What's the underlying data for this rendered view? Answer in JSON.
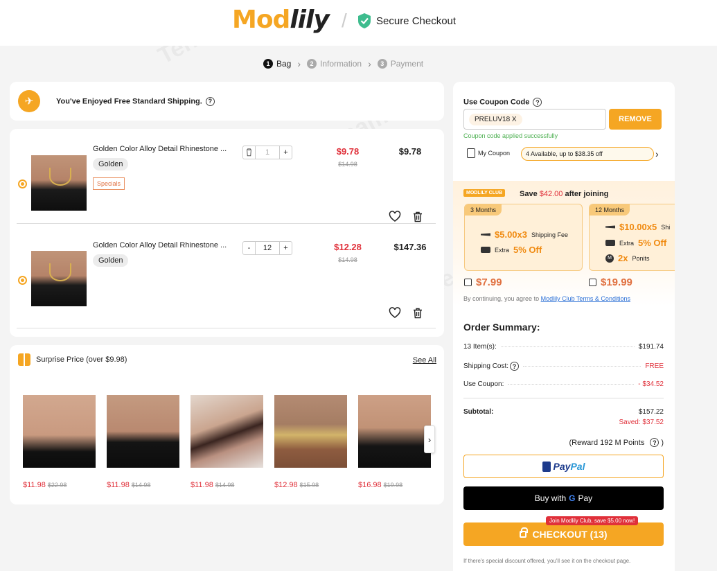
{
  "header": {
    "logo_part1": "Mod",
    "logo_part2": "lily",
    "secure_label": "Secure Checkout"
  },
  "steps": [
    {
      "num": "1",
      "label": "Bag"
    },
    {
      "num": "2",
      "label": "Information"
    },
    {
      "num": "3",
      "label": "Payment"
    }
  ],
  "shipping": {
    "text": "You've Enjoyed Free Standard Shipping."
  },
  "bag": {
    "items": [
      {
        "name": "Golden Color Alloy Detail Rhinestone ...",
        "variant": "Golden",
        "badge": "Specials",
        "qty": "1",
        "price": "$9.78",
        "original": "$14.98",
        "total": "$9.78"
      },
      {
        "name": "Golden Color Alloy Detail Rhinestone ...",
        "variant": "Golden",
        "qty": "12",
        "price": "$12.28",
        "original": "$14.98",
        "total": "$147.36"
      }
    ],
    "minus": "-",
    "plus": "+"
  },
  "surprise": {
    "title": "Surprise Price (over $9.98)",
    "see_all": "See All",
    "products": [
      {
        "price": "$11.98",
        "original": "$22.98"
      },
      {
        "price": "$11.98",
        "original": "$14.98"
      },
      {
        "price": "$11.98",
        "original": "$14.98"
      },
      {
        "price": "$12.98",
        "original": "$15.98"
      },
      {
        "price": "$16.98",
        "original": "$19.98"
      }
    ],
    "next": "›"
  },
  "coupon": {
    "label": "Use Coupon Code",
    "applied_code": "PRELUV18  X",
    "remove": "REMOVE",
    "success": "Coupon code applied successfully",
    "my_coupon": "My Coupon",
    "available": "4 Available, up to $38.35 off",
    "chev": "›"
  },
  "club": {
    "badge": "MODLILY CLUB",
    "save_prefix": "Save ",
    "save_amount": "$42.00",
    "save_suffix": " after joining",
    "plans": [
      {
        "tag": "3 Months",
        "fee_big": "$5.00x3",
        "fee_label": "Shipping Fee",
        "extra_label": "Extra ",
        "extra_big": "5% Off",
        "price": "$7.99"
      },
      {
        "tag": "12 Months",
        "fee_big": "$10.00x5",
        "fee_label": "Shi",
        "extra_label": "Extra ",
        "extra_big": "5% Off",
        "points_big": "2x",
        "points_label": "Ponits",
        "price": "$19.99"
      }
    ],
    "terms_prefix": "By continuing, you agree to ",
    "terms_link": "Modlily Club Terms & Conditions"
  },
  "summary": {
    "title": "Order Summary:",
    "items_label": "13 Item(s):",
    "items_value": "$191.74",
    "shipping_label": "Shipping Cost:",
    "shipping_value": "FREE",
    "coupon_label": "Use Coupon:",
    "coupon_value": "- $34.52",
    "subtotal_label": "Subtotal:",
    "subtotal_value": "$157.22",
    "saved": "Saved: $37.52",
    "reward": "(Reward 192 M Points"
  },
  "payment": {
    "paypal_a": "Pay",
    "paypal_b": "Pal",
    "gpay_prefix": "Buy with",
    "gpay_g": "G",
    "gpay_suffix": "Pay",
    "checkout": "CHECKOUT (13)",
    "join_tip": "Join Modlily Club, save $5.00 now!",
    "note": "If there's special discount offered, you'll see it on the checkout page."
  },
  "watermark": "Tenereteam",
  "colors": {
    "accent": "#f5a623",
    "sale": "#e0303a",
    "success": "#4caf50"
  }
}
